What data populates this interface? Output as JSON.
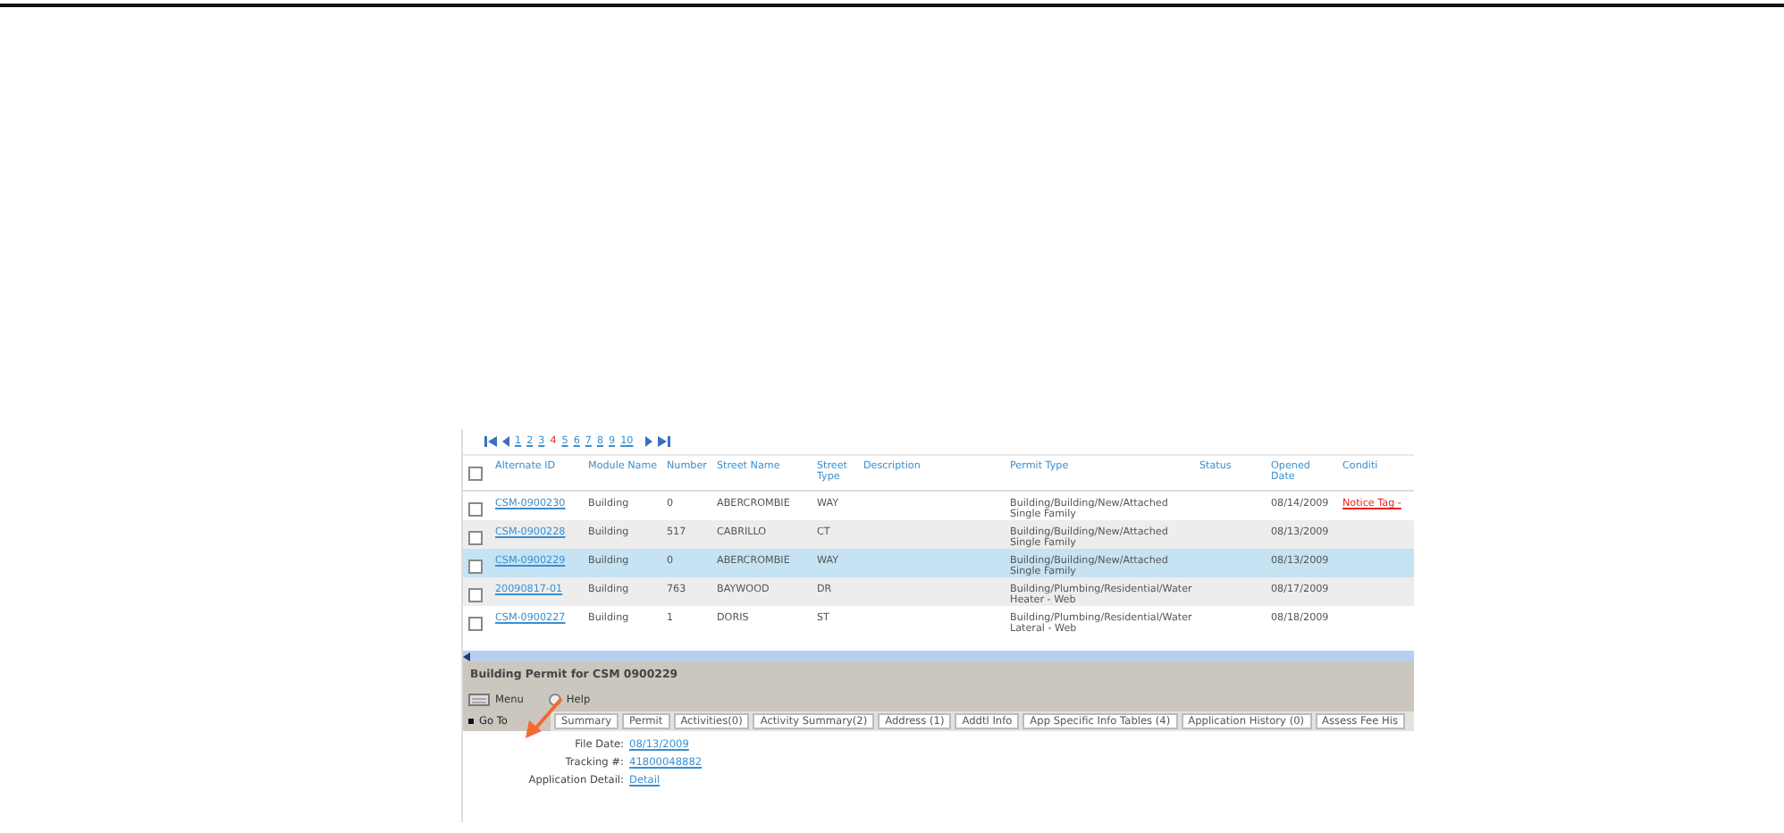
{
  "pager": {
    "pages": [
      {
        "label": "1",
        "selected": false
      },
      {
        "label": "2",
        "selected": false
      },
      {
        "label": "3",
        "selected": false
      },
      {
        "label": "4",
        "selected": true
      },
      {
        "label": "5",
        "selected": false
      },
      {
        "label": "6",
        "selected": false
      },
      {
        "label": "7",
        "selected": false
      },
      {
        "label": "8",
        "selected": false
      },
      {
        "label": "9",
        "selected": false
      },
      {
        "label": "10",
        "selected": false
      }
    ]
  },
  "table": {
    "all_checked": false,
    "columns": [
      "Alternate ID",
      "Module Name",
      "Number",
      "Street Name",
      "Street Type",
      "Description",
      "Permit Type",
      "Status",
      "Opened Date",
      "Conditi"
    ],
    "rows": [
      {
        "checked": false,
        "selected": false,
        "cells": [
          "CSM-0900230",
          "Building",
          "0",
          "ABERCROMBIE",
          "WAY",
          "",
          "Building/Building/New/Attached Single Family",
          "",
          "08/14/2009",
          "Notice Tag -"
        ]
      },
      {
        "checked": false,
        "selected": false,
        "cells": [
          "CSM-0900228",
          "Building",
          "517",
          "CABRILLO",
          "CT",
          "",
          "Building/Building/New/Attached Single Family",
          "",
          "08/13/2009",
          ""
        ]
      },
      {
        "checked": false,
        "selected": true,
        "cells": [
          "CSM-0900229",
          "Building",
          "0",
          "ABERCROMBIE",
          "WAY",
          "",
          "Building/Building/New/Attached Single Family",
          "",
          "08/13/2009",
          ""
        ]
      },
      {
        "checked": false,
        "selected": false,
        "cells": [
          "20090817-01",
          "Building",
          "763",
          "BAYWOOD",
          "DR",
          "",
          "Building/Plumbing/Residential/Water Heater - Web",
          "",
          "08/17/2009",
          ""
        ]
      },
      {
        "checked": false,
        "selected": false,
        "cells": [
          "CSM-0900227",
          "Building",
          "1",
          "DORIS",
          "ST",
          "",
          "Building/Plumbing/Residential/Water Lateral - Web",
          "",
          "08/18/2009",
          ""
        ]
      }
    ]
  },
  "detail": {
    "title": "Building Permit for CSM 0900229",
    "toolbar": [
      "Menu",
      "Help"
    ],
    "goto": "Go To",
    "tabs": [
      "Summary",
      "Permit",
      "Activities(0)",
      "Activity Summary(2)",
      "Address (1)",
      "Addtl Info",
      "App Specific Info Tables (4)",
      "Application History (0)",
      "Assess Fee His"
    ],
    "fields": [
      {
        "label": "File Date:",
        "value": "08/13/2009"
      },
      {
        "label": "Tracking #:",
        "value": "41800048882"
      },
      {
        "label": "Application Detail:",
        "value": "Detail"
      }
    ]
  }
}
